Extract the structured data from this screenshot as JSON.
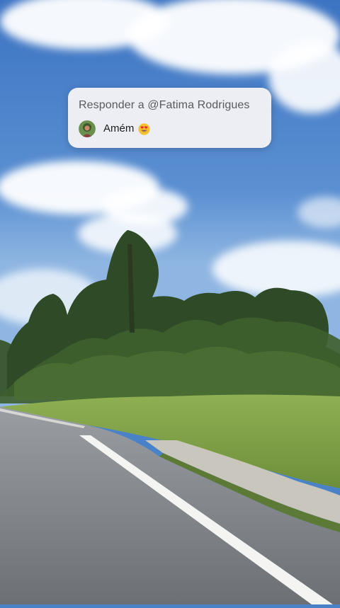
{
  "reply_card": {
    "title": "Responder a @Fatima Rodrigues",
    "comment_text": "Amém",
    "avatar_icon": "user-avatar-photo",
    "emoji_icon": "heart-eyes-emoji-icon"
  },
  "colors": {
    "sky": "#4a82c8",
    "card_background": "#f2f2f6",
    "title_text": "#5a5a5e",
    "comment_text": "#1c1c1e",
    "road": "#7b7f84",
    "grass": "#7da348"
  }
}
